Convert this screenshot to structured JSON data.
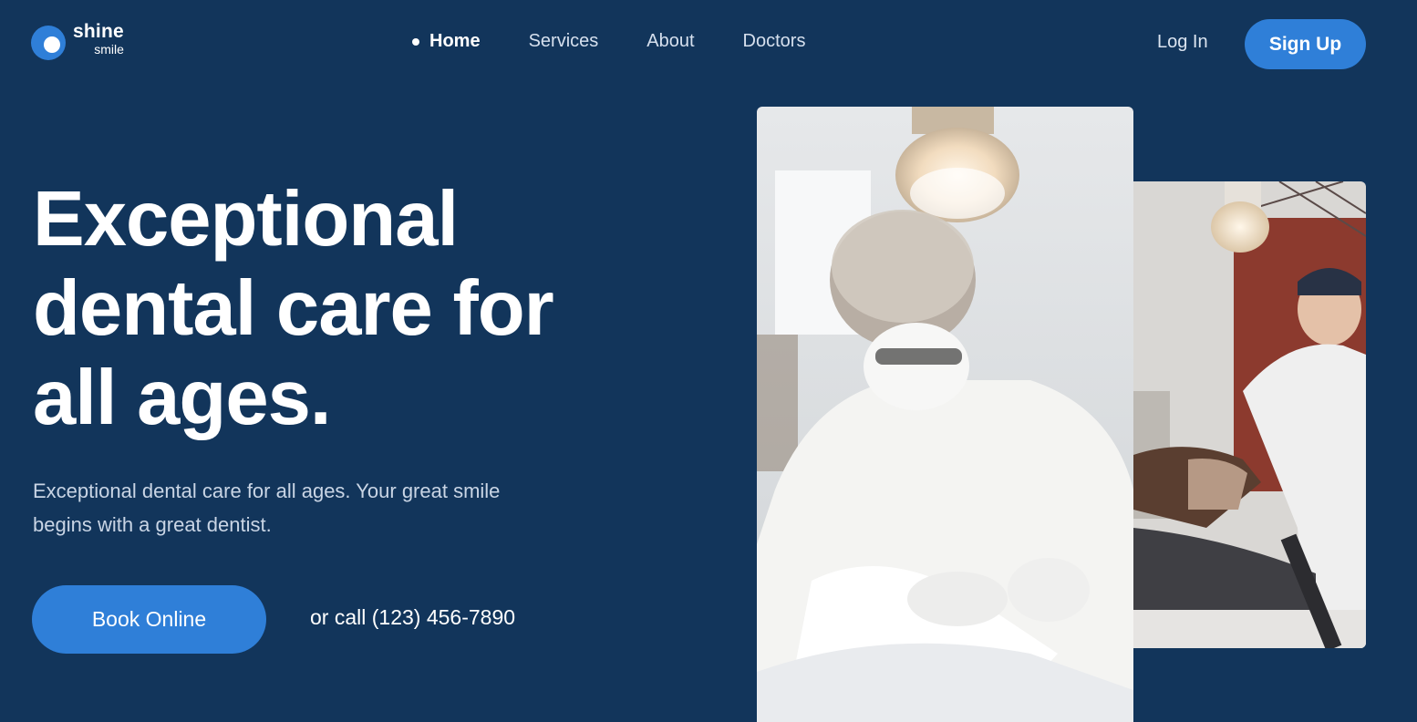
{
  "brand": {
    "name_line1": "shine",
    "name_line2": "smile",
    "accent": "#2f7fd8",
    "background": "#12355b"
  },
  "nav": {
    "items": [
      {
        "label": "Home",
        "active": true
      },
      {
        "label": "Services",
        "active": false
      },
      {
        "label": "About",
        "active": false
      },
      {
        "label": "Doctors",
        "active": false
      }
    ]
  },
  "auth": {
    "login_label": "Log In",
    "signup_label": "Sign Up"
  },
  "hero": {
    "headline_lines": [
      "Exceptional",
      "dental care for",
      "all ages."
    ],
    "subtext_line1": "Exceptional dental care for all ages. Your great smile",
    "subtext_line2": "begins with a great dentist.",
    "book_label": "Book Online",
    "call_prefix": "or call",
    "phone": "(123) 456-7890"
  },
  "images": [
    {
      "icon": "photo-dentist-surgery"
    },
    {
      "icon": "photo-dentist-patient"
    }
  ]
}
